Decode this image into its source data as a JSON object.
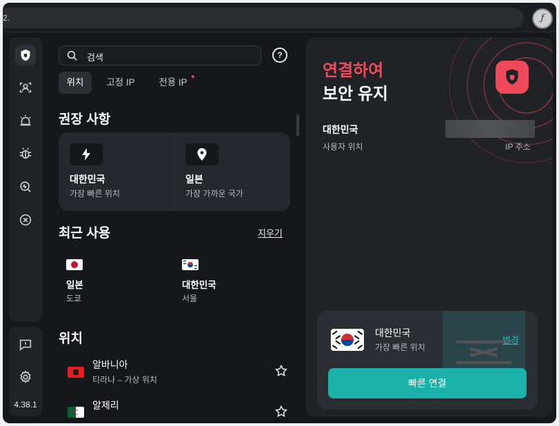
{
  "browser": {
    "address_text": "2."
  },
  "sidebar": {
    "version": "4.38.1"
  },
  "search": {
    "placeholder": "검색"
  },
  "tabs": [
    {
      "label": "위치",
      "active": true
    },
    {
      "label": "고정 IP",
      "active": false
    },
    {
      "label": "전용 IP",
      "active": false,
      "badge": true
    }
  ],
  "recommended": {
    "heading": "권장 사항",
    "items": [
      {
        "title": "대한민국",
        "subtitle": "가장 빠른 위치",
        "icon": "lightning-icon"
      },
      {
        "title": "일본",
        "subtitle": "가장 가까운 국가",
        "icon": "location-pin-icon"
      }
    ]
  },
  "recent": {
    "heading": "최근 사용",
    "clear_label": "지우기",
    "items": [
      {
        "country": "일본",
        "city": "도쿄",
        "flag": "japan-flag"
      },
      {
        "country": "대한민국",
        "city": "서울",
        "flag": "korea-flag"
      }
    ]
  },
  "locations": {
    "heading": "위치",
    "items": [
      {
        "country": "알바니아",
        "detail": "티라나 – 가상 위치",
        "flag": "albania-flag"
      },
      {
        "country": "알제리",
        "detail": "",
        "flag": "algeria-flag"
      }
    ]
  },
  "status": {
    "line1": "연결하여",
    "line2": "보안 유지",
    "location_value": "대한민국",
    "location_label": "사용자 위치",
    "ip_label": "IP 주소",
    "accent_color": "#f04a5a"
  },
  "quick_connect": {
    "country": "대한민국",
    "subtitle": "가장 빠른 위치",
    "change_label": "변경",
    "button_label": "빠른 연결",
    "button_color": "#1bb0aa"
  }
}
